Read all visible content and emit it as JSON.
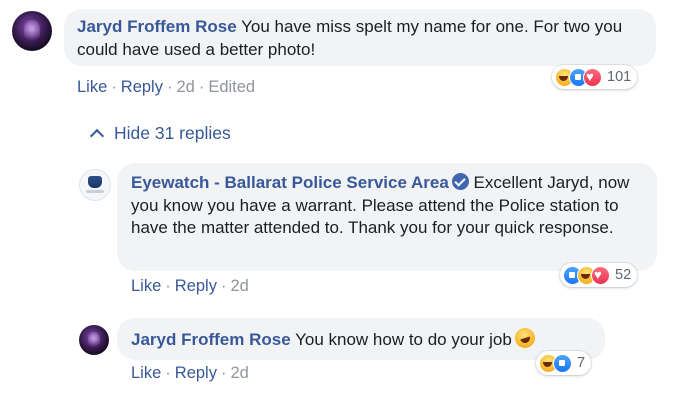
{
  "comment1": {
    "author": "Jaryd Froffem Rose",
    "text": "You have miss spelt my name for one. For two you could have used a better photo!",
    "like": "Like",
    "reply": "Reply",
    "time": "2d",
    "edited": "Edited",
    "reactions": {
      "icons": [
        "haha-icon",
        "like-icon",
        "love-icon"
      ],
      "count": "101"
    }
  },
  "hide_replies": {
    "label": "Hide 31 replies",
    "icon": "chevron-up-icon"
  },
  "comment2": {
    "author": "Eyewatch - Ballarat Police Service Area",
    "verified": true,
    "text": "Excellent Jaryd, now you know you have a warrant. Please attend the Police station to have the matter attended to. Thank you for your quick response.",
    "like": "Like",
    "reply": "Reply",
    "time": "2d",
    "reactions": {
      "icons": [
        "like-icon",
        "haha-icon",
        "love-icon"
      ],
      "count": "52"
    }
  },
  "comment3": {
    "author": "Jaryd Froffem Rose",
    "text": "You know how to do your job",
    "like": "Like",
    "reply": "Reply",
    "time": "2d",
    "reactions": {
      "icons": [
        "haha-icon",
        "like-icon"
      ],
      "count": "7"
    }
  },
  "colors": {
    "link": "#385898",
    "bubble": "#f2f3f5",
    "meta": "#90949c"
  }
}
